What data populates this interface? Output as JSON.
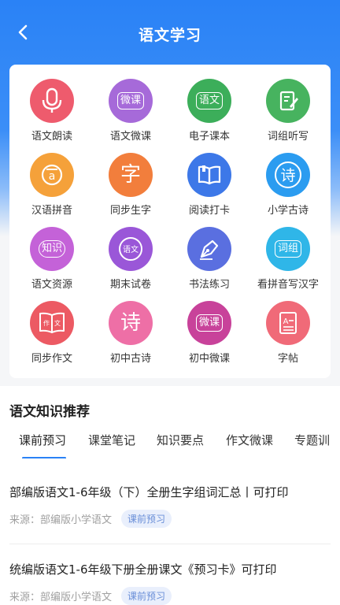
{
  "header": {
    "title": "语文学习",
    "back_icon": "chevron-left-icon"
  },
  "grid": {
    "items": [
      {
        "label": "语文朗读",
        "icon": "microphone-icon",
        "color": "#ee5b6d"
      },
      {
        "label": "语文微课",
        "icon": "micro-lesson-icon",
        "glyph": "微课",
        "color": "#a66ad9"
      },
      {
        "label": "电子课本",
        "icon": "textbook-icon",
        "glyph": "语文",
        "color": "#3cae5a"
      },
      {
        "label": "词组听写",
        "icon": "notepad-pen-icon",
        "color": "#47b35f"
      },
      {
        "label": "汉语拼音",
        "icon": "pinyin-icon",
        "glyph": "a",
        "color": "#f5a13a"
      },
      {
        "label": "同步生字",
        "icon": "character-icon",
        "glyph": "字",
        "color": "#f27e3c"
      },
      {
        "label": "阅读打卡",
        "icon": "open-book-icon",
        "color": "#3d78e8"
      },
      {
        "label": "小学古诗",
        "icon": "poem-icon",
        "glyph": "诗",
        "color": "#2b9cf0"
      },
      {
        "label": "语文资源",
        "icon": "knowledge-icon",
        "glyph": "知识",
        "color": "#c462d8"
      },
      {
        "label": "期末试卷",
        "icon": "exam-icon",
        "glyph": "语文",
        "color": "#9a57d8"
      },
      {
        "label": "书法练习",
        "icon": "fountain-pen-icon",
        "color": "#5a6fe0"
      },
      {
        "label": "看拼音写汉字",
        "icon": "phrase-icon",
        "glyph": "词组",
        "color": "#2fb6e8"
      },
      {
        "label": "同步作文",
        "icon": "composition-book-icon",
        "glyph": "作文",
        "color": "#ec5a63"
      },
      {
        "label": "初中古诗",
        "icon": "poem-icon",
        "glyph": "诗",
        "color": "#ee6fa6"
      },
      {
        "label": "初中微课",
        "icon": "micro-lesson-icon",
        "glyph": "微课",
        "color": "#c8429a"
      },
      {
        "label": "字帖",
        "icon": "copybook-icon",
        "glyph": "A",
        "color": "#f06a78"
      }
    ]
  },
  "section": {
    "title": "语文知识推荐",
    "tabs": [
      "课前预习",
      "课堂笔记",
      "知识要点",
      "作文微课",
      "专题训"
    ],
    "active_tab": "课前预习",
    "articles": [
      {
        "title": "部编版语文1-6年级（下）全册生字组词汇总丨可打印",
        "source": "来源：部编版小学语文",
        "badge": "课前预习"
      },
      {
        "title": "统编版语文1-6年级下册全册课文《预习卡》可打印",
        "source": "来源：部编版小学语文",
        "badge": "课前预习"
      }
    ]
  },
  "colors": {
    "accent": "#2a82f6",
    "badge_bg": "#e9effc",
    "badge_text": "#6a8fd8"
  }
}
